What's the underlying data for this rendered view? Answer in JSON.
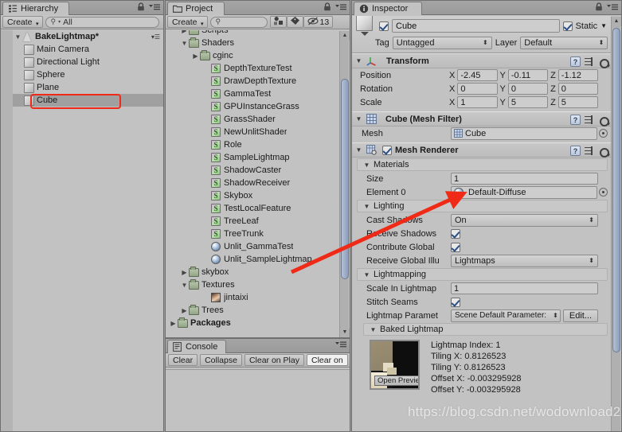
{
  "hierarchy": {
    "tab": "Hierarchy",
    "tab_icon": "hierarchy-icon",
    "create_label": "Create",
    "search_placeholder": "All",
    "search_value": "All",
    "scene": {
      "name": "BakeLightmap*",
      "expanded": true
    },
    "items": [
      {
        "label": "Main Camera",
        "icon": "gameobject-icon",
        "selected": false
      },
      {
        "label": "Directional Light",
        "icon": "gameobject-icon",
        "selected": false
      },
      {
        "label": "Sphere",
        "icon": "gameobject-icon",
        "selected": false
      },
      {
        "label": "Plane",
        "icon": "gameobject-icon",
        "selected": false
      },
      {
        "label": "Cube",
        "icon": "gameobject-icon",
        "selected": true
      }
    ]
  },
  "project": {
    "tab": "Project",
    "create_label": "Create",
    "search_placeholder": "",
    "hidden_count": "13",
    "items": [
      {
        "label": "Scripts",
        "type": "folder",
        "indent": 1,
        "expanded": false
      },
      {
        "label": "Shaders",
        "type": "folder",
        "indent": 1,
        "expanded": true
      },
      {
        "label": "cginc",
        "type": "folder",
        "indent": 2,
        "expanded": false
      },
      {
        "label": "DepthTextureTest",
        "type": "shader",
        "indent": 3
      },
      {
        "label": "DrawDepthTexture",
        "type": "shader",
        "indent": 3
      },
      {
        "label": "GammaTest",
        "type": "shader",
        "indent": 3
      },
      {
        "label": "GPUInstanceGrass",
        "type": "shader",
        "indent": 3
      },
      {
        "label": "GrassShader",
        "type": "shader",
        "indent": 3
      },
      {
        "label": "NewUnlitShader",
        "type": "shader",
        "indent": 3
      },
      {
        "label": "Role",
        "type": "shader",
        "indent": 3
      },
      {
        "label": "SampleLightmap",
        "type": "shader",
        "indent": 3
      },
      {
        "label": "ShadowCaster",
        "type": "shader",
        "indent": 3
      },
      {
        "label": "ShadowReceiver",
        "type": "shader",
        "indent": 3
      },
      {
        "label": "Skybox",
        "type": "shader",
        "indent": 3
      },
      {
        "label": "TestLocalFeature",
        "type": "shader",
        "indent": 3
      },
      {
        "label": "TreeLeaf",
        "type": "shader",
        "indent": 3
      },
      {
        "label": "TreeTrunk",
        "type": "shader",
        "indent": 3
      },
      {
        "label": "Unlit_GammaTest",
        "type": "material",
        "indent": 3
      },
      {
        "label": "Unlit_SampleLightmap",
        "type": "material",
        "indent": 3
      },
      {
        "label": "skybox",
        "type": "folder",
        "indent": 1,
        "expanded": false
      },
      {
        "label": "Textures",
        "type": "folder",
        "indent": 1,
        "expanded": true
      },
      {
        "label": "jintaixi",
        "type": "texture",
        "indent": 3
      },
      {
        "label": "Trees",
        "type": "folder",
        "indent": 1,
        "expanded": false
      },
      {
        "label": "Packages",
        "type": "folder",
        "indent": 0,
        "expanded": false,
        "bold": true
      }
    ]
  },
  "console": {
    "tab": "Console",
    "buttons": [
      "Clear",
      "Collapse",
      "Clear on Play",
      "Clear on"
    ]
  },
  "inspector": {
    "tab": "Inspector",
    "object_name": "Cube",
    "object_enabled": true,
    "static_label": "Static",
    "static_checked": true,
    "tag_label": "Tag",
    "tag_value": "Untagged",
    "layer_label": "Layer",
    "layer_value": "Default",
    "transform": {
      "title": "Transform",
      "rows": [
        {
          "label": "Position",
          "x": "-2.45",
          "y": "-0.11",
          "z": "-1.12"
        },
        {
          "label": "Rotation",
          "x": "0",
          "y": "0",
          "z": "0"
        },
        {
          "label": "Scale",
          "x": "1",
          "y": "5",
          "z": "5"
        }
      ]
    },
    "mesh_filter": {
      "title": "Cube (Mesh Filter)",
      "mesh_label": "Mesh",
      "mesh_value": "Cube"
    },
    "mesh_renderer": {
      "title": "Mesh Renderer",
      "enabled": true,
      "materials_label": "Materials",
      "size_label": "Size",
      "size_value": "1",
      "element_label": "Element 0",
      "element_value": "Default-Diffuse",
      "lighting_label": "Lighting",
      "cast_shadows_label": "Cast Shadows",
      "cast_shadows_value": "On",
      "receive_shadows_label": "Receive Shadows",
      "receive_shadows_checked": true,
      "contribute_global_label": "Contribute Global",
      "contribute_global_checked": true,
      "receive_gi_label": "Receive Global Illu",
      "receive_gi_value": "Lightmaps",
      "lightmapping_label": "Lightmapping",
      "scale_in_lightmap_label": "Scale In Lightmap",
      "scale_in_lightmap_value": "1",
      "stitch_seams_label": "Stitch Seams",
      "stitch_seams_checked": true,
      "lightmap_parameters_label": "Lightmap Paramet",
      "lightmap_parameters_value": "Scene Default Parameter:",
      "edit_label": "Edit...",
      "baked_lightmap_label": "Baked Lightmap",
      "open_preview_label": "Open Preview",
      "baked_stats": [
        "Lightmap Index: 1",
        "Tiling X: 0.8126523",
        "Tiling Y: 0.8126523",
        "Offset X: -0.003295928",
        "Offset Y: -0.003295928"
      ]
    }
  },
  "annotations": {
    "watermark": "https://blog.csdn.net/wodownload2",
    "highlight_color": "#ef2b18",
    "arrow_color": "#ef2b18"
  }
}
